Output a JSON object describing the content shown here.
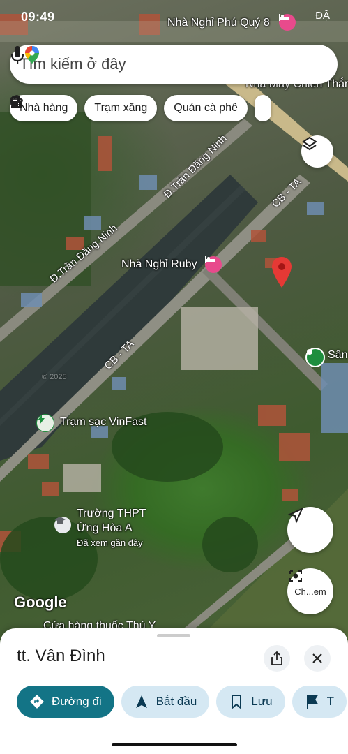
{
  "status": {
    "time": "09:49",
    "right_text": "ĐẶ"
  },
  "search": {
    "placeholder": "Tìm kiếm ở đây"
  },
  "chips": [
    {
      "label": "Nhà hàng",
      "icon": "fork-knife-icon"
    },
    {
      "label": "Trạm xăng",
      "icon": "gas-station-icon"
    },
    {
      "label": "Quán cà phê",
      "icon": "coffee-icon"
    }
  ],
  "map": {
    "labels": {
      "nha_nghi_phu_quy": "Nhà Nghỉ Phú Quý 8",
      "nha_may": "Nhà Máy Chiến Thắng",
      "nha_nghi_ruby": "Nhà Nghỉ Ruby",
      "tram_sac": "Trạm sạc VinFast",
      "truong_line1": "Trường THPT",
      "truong_line2": "Ứng Hòa A",
      "truong_sub": "Đã xem gần đây",
      "cua_hang": "Cửa hàng thuốc Thú Y",
      "san": "Sân",
      "watermark": "Google",
      "copyright": "© 2025"
    },
    "roads": {
      "tran_dang_ninh_1": "Đ.Trần Đăng Ninh",
      "tran_dang_ninh_2": "Đ.Trần Đăng Ninh",
      "cb_ta_1": "CB - TA",
      "cb_ta_2": "CB - TA"
    },
    "camera_label": "Ch...em"
  },
  "sheet": {
    "title": "tt. Vân Đình",
    "actions": [
      {
        "label": "Đường đi",
        "icon": "directions-icon"
      },
      {
        "label": "Bắt đầu",
        "icon": "navigation-arrow-icon"
      },
      {
        "label": "Lưu",
        "icon": "bookmark-icon"
      },
      {
        "label": "T",
        "icon": "flag-icon"
      }
    ]
  },
  "colors": {
    "accent": "#137486",
    "pin": "#e53935",
    "poi_pink": "#e84a8c",
    "poi_green": "#1e8e3e",
    "chip_text": "#1f1f1f"
  }
}
